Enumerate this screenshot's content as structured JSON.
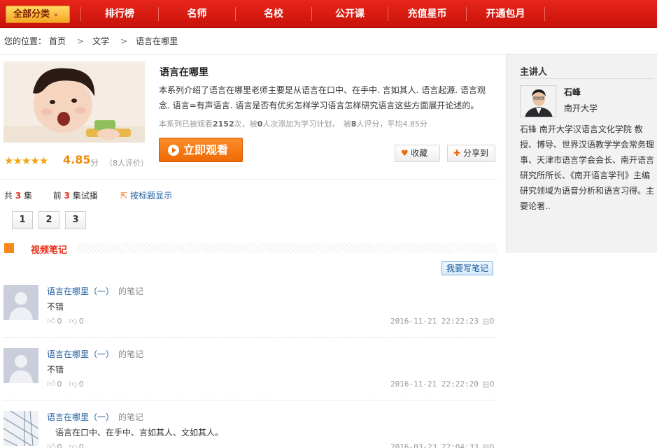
{
  "nav": {
    "all_categories": "全部分类",
    "items": [
      "排行榜",
      "名师",
      "名校",
      "公开课",
      "充值星币",
      "开通包月"
    ]
  },
  "breadcrumb": {
    "prefix": "您的位置：",
    "items": [
      "首页",
      "文学",
      "语言在哪里"
    ]
  },
  "course": {
    "title": "语言在哪里",
    "description": "本系列介绍了语言在哪里老师主要是从语言在口中、在手中. 言如其人. 语言起源. 语言观念. 语言=有声语言. 语言是否有优劣怎样学习语言怎样研究语言这些方面展开论述的。",
    "stats": {
      "s1": "本系列已被观看",
      "views": "2152",
      "s2": "次，被",
      "plans": "0",
      "s3": "人次添加为学习计划，　被",
      "raters": "8",
      "s4": "人评分，平均",
      "avg": "4.85",
      "s5": "分"
    },
    "score": "4.85",
    "score_unit": "分",
    "score_count": "（8人评价）",
    "stars_rating": 5,
    "watch_label": "立即观看",
    "fav_label": "收藏",
    "share_label": "分享到"
  },
  "episodes": {
    "total_prefix": "共",
    "total": "3",
    "total_suffix": "集",
    "trial_prefix": "前",
    "trial": "3",
    "trial_suffix": "集试播",
    "by_title": "按标题显示",
    "buttons": [
      "1",
      "2",
      "3"
    ]
  },
  "notes": {
    "heading": "视频笔记",
    "write_label": "我要写笔记",
    "items": [
      {
        "title": "语言在哪里（一）",
        "suffix": "的笔记",
        "body": "不错",
        "likes": "0",
        "dislikes": "0",
        "time": "2016-11-21 22:22:23",
        "comments": "0"
      },
      {
        "title": "语言在哪里（一）",
        "suffix": "的笔记",
        "body": "不错",
        "likes": "0",
        "dislikes": "0",
        "time": "2016-11-21 22:22:20",
        "comments": "0"
      },
      {
        "title": "语言在哪里（一）",
        "suffix": "的笔记",
        "body": "　语言在口中、在手中、言如其人、文如其人。",
        "likes": "0",
        "dislikes": "0",
        "time": "2016-03-23 22:04:33",
        "comments": "0"
      }
    ]
  },
  "lecturer": {
    "heading": "主讲人",
    "name": "石峰",
    "school": "南开大学",
    "bio": "石锋 南开大学汉语言文化学院 教授、博导、世界汉语教学学会常务理事、天津市语言学会会长、南开语言研究所所长、《南开语言学刊》主编 研究领域为语音分析和语言习得。主要论著.."
  },
  "colors": {
    "nav_red": "#d81c10",
    "accent_orange": "#ee6a06",
    "link_blue": "#1b5b9b"
  }
}
